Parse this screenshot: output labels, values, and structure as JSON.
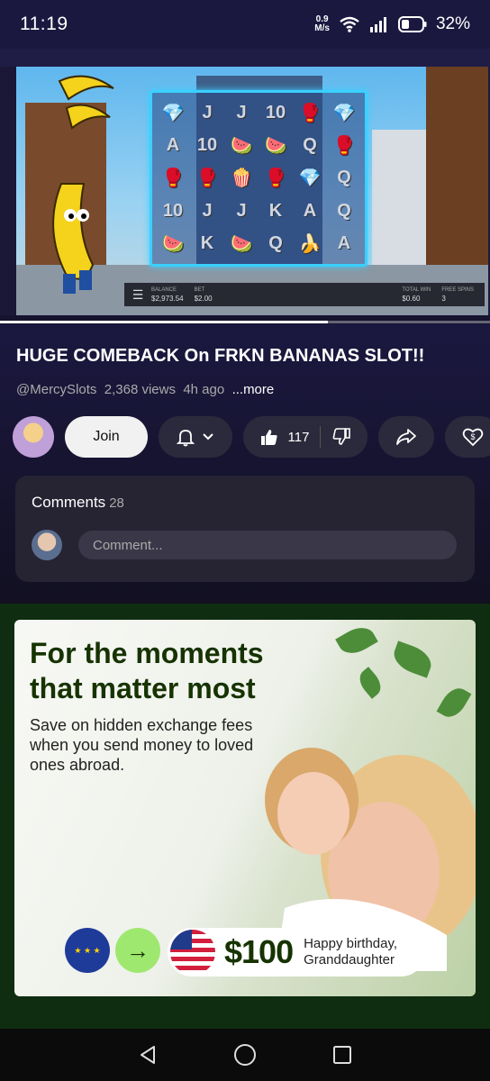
{
  "status_bar": {
    "time": "11:19",
    "net_speed_value": "0.9",
    "net_speed_unit": "M/s",
    "battery": "32%"
  },
  "video": {
    "progress_fraction": 0.67,
    "game": {
      "balance_label": "BALANCE",
      "balance": "$2,973.54",
      "bet_label": "BET",
      "bet": "$2.00",
      "total_win_label": "TOTAL WIN",
      "total_win": "$0.60",
      "free_spins_label": "FREE SPINS",
      "free_spins": "3",
      "symbols": [
        [
          "💎",
          "J",
          "J",
          "10",
          "🥊",
          "💎"
        ],
        [
          "A",
          "10",
          "🍉",
          "🍉",
          "Q",
          "🥊"
        ],
        [
          "🥊",
          "🥊",
          "🍿",
          "🥊",
          "💎",
          "Q"
        ],
        [
          "10",
          "J",
          "J",
          "K",
          "A",
          "Q"
        ],
        [
          "🍉",
          "K",
          "🍉",
          "Q",
          "🍌",
          "A"
        ]
      ]
    }
  },
  "info": {
    "title": "HUGE COMEBACK On FRKN BANANAS SLOT!!",
    "channel": "@MercySlots",
    "views": "2,368 views",
    "age": "4h ago",
    "more": "...more",
    "join_label": "Join",
    "like_count": "117"
  },
  "comments": {
    "heading": "Comments",
    "count": "28",
    "placeholder": "Comment..."
  },
  "ad": {
    "headline": "For the moments that matter most",
    "body": "Save on hidden exchange fees when you send money to loved ones abroad.",
    "amount": "$100",
    "promo_line1": "Happy birthday,",
    "promo_line2": "Granddaughter",
    "brand_green": "#163300",
    "accent_green": "#9fe870"
  },
  "icons": [
    "bell-icon",
    "chevron-down-icon",
    "thumb-up-icon",
    "thumb-down-icon",
    "share-icon",
    "thanks-icon",
    "back-icon",
    "home-icon",
    "recents-icon",
    "wifi-icon",
    "signal-icon",
    "battery-icon"
  ]
}
